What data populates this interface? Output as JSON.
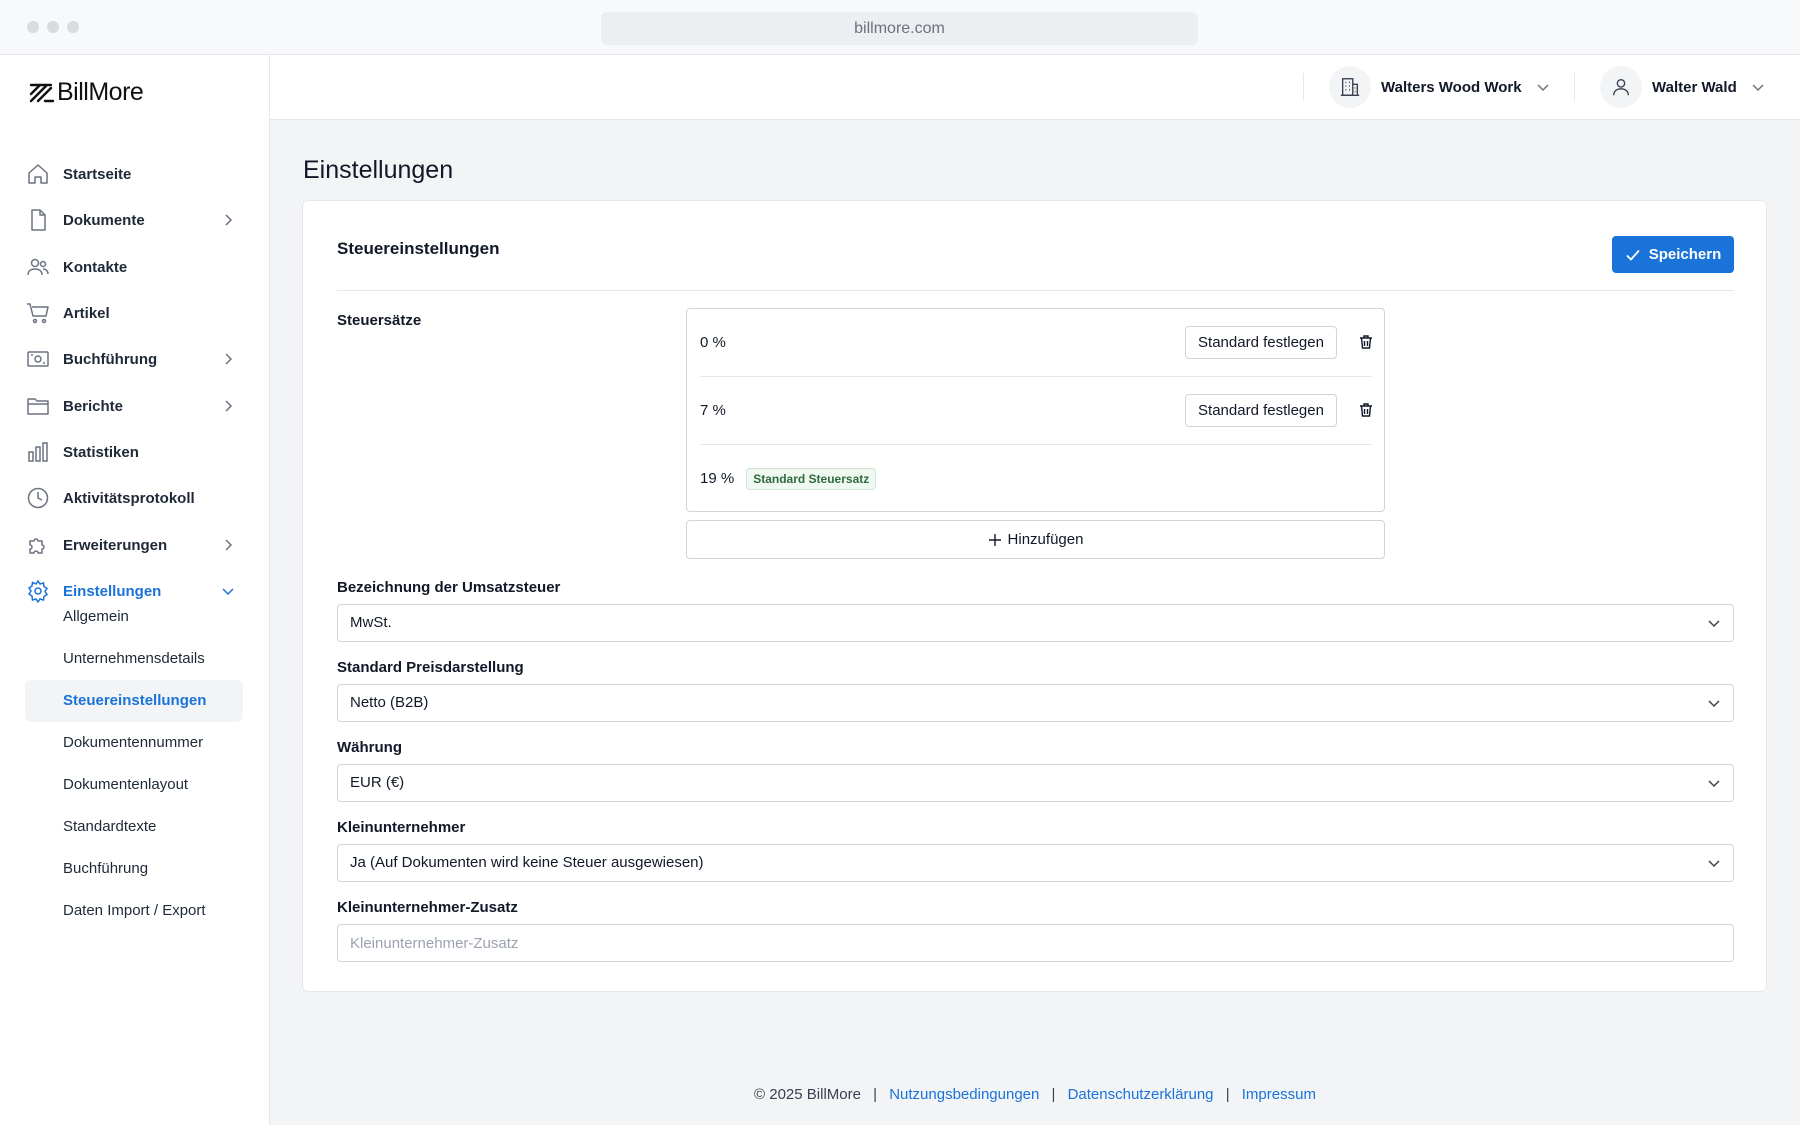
{
  "browser": {
    "url": "billmore.com"
  },
  "brand": {
    "name": "BillMore",
    "accent": "#1a73d9"
  },
  "sidebar": {
    "items": [
      {
        "label": "Startseite",
        "icon": "home-icon"
      },
      {
        "label": "Dokumente",
        "icon": "document-icon",
        "has_children": true
      },
      {
        "label": "Kontakte",
        "icon": "users-icon"
      },
      {
        "label": "Artikel",
        "icon": "cart-icon"
      },
      {
        "label": "Buchführung",
        "icon": "money-icon",
        "has_children": true
      },
      {
        "label": "Berichte",
        "icon": "folder-icon",
        "has_children": true
      },
      {
        "label": "Statistiken",
        "icon": "bar-chart-icon"
      },
      {
        "label": "Aktivitätsprotokoll",
        "icon": "clock-icon"
      },
      {
        "label": "Erweiterungen",
        "icon": "puzzle-icon",
        "has_children": true
      },
      {
        "label": "Einstellungen",
        "icon": "gear-icon",
        "has_children": true,
        "expanded": true,
        "active": true
      }
    ],
    "subitems": [
      {
        "label": "Allgemein"
      },
      {
        "label": "Unternehmensdetails"
      },
      {
        "label": "Steuereinstellungen",
        "active": true
      },
      {
        "label": "Dokumentennummer"
      },
      {
        "label": "Dokumentenlayout"
      },
      {
        "label": "Standardtexte"
      },
      {
        "label": "Buchführung"
      },
      {
        "label": "Daten Import / Export"
      }
    ]
  },
  "header": {
    "company": "Walters Wood Work",
    "user": "Walter Wald"
  },
  "page": {
    "title": "Einstellungen"
  },
  "tax": {
    "section_title": "Steuereinstellungen",
    "save_label": "Speichern",
    "rates_label": "Steuersätze",
    "rates": [
      {
        "value": "0 %",
        "action": "Standard festlegen"
      },
      {
        "value": "7 %",
        "action": "Standard festlegen"
      },
      {
        "value": "19 %",
        "badge": "Standard Steuersatz"
      }
    ],
    "add_label": "Hinzufügen",
    "fields": [
      {
        "label": "Bezeichnung der Umsatzsteuer",
        "value": "MwSt."
      },
      {
        "label": "Standard Preisdarstellung",
        "value": "Netto (B2B)"
      },
      {
        "label": "Währung",
        "value": "EUR (€)"
      },
      {
        "label": "Kleinunternehmer",
        "value": "Ja (Auf Dokumenten wird keine Steuer ausgewiesen)"
      }
    ],
    "zusatz": {
      "label": "Kleinunternehmer-Zusatz",
      "placeholder": "Kleinunternehmer-Zusatz",
      "value": ""
    }
  },
  "footer": {
    "copyright": "© 2025 BillMore",
    "sep": "|",
    "links": [
      "Nutzungsbedingungen",
      "Datenschutzerklärung",
      "Impressum"
    ]
  }
}
